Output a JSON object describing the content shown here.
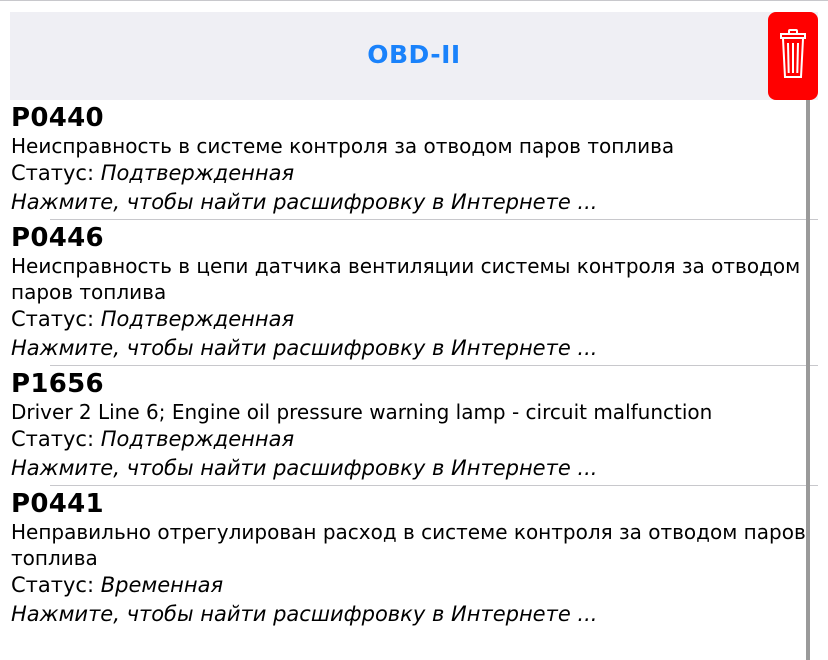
{
  "header": {
    "title": "OBD-II",
    "trash_icon": "trash-icon",
    "accent_color": "#1a82fb",
    "delete_color": "#ff0000"
  },
  "list": {
    "items": [
      {
        "code": "P0440",
        "description": "Неисправность в системе контроля за отводом паров топлива",
        "status_label": "Статус:",
        "status_value": "Подтвержденная",
        "hint": "Нажмите, чтобы найти расшифровку в Интернете ..."
      },
      {
        "code": "P0446",
        "description": "Неисправность в цепи датчика вентиляции системы контроля за отводом паров топлива",
        "status_label": "Статус:",
        "status_value": "Подтвержденная",
        "hint": "Нажмите, чтобы найти расшифровку в Интернете ..."
      },
      {
        "code": "P1656",
        "description": "Driver 2 Line 6; Engine oil pressure warning lamp - circuit malfunction",
        "status_label": "Статус:",
        "status_value": "Подтвержденная",
        "hint": "Нажмите, чтобы найти расшифровку в Интернете ..."
      },
      {
        "code": "P0441",
        "description": "Неправильно отрегулирован расход в системе контроля за отводом паров топлива",
        "status_label": "Статус:",
        "status_value": "Временная",
        "hint": "Нажмите, чтобы найти расшифровку в Интернете ..."
      }
    ]
  }
}
